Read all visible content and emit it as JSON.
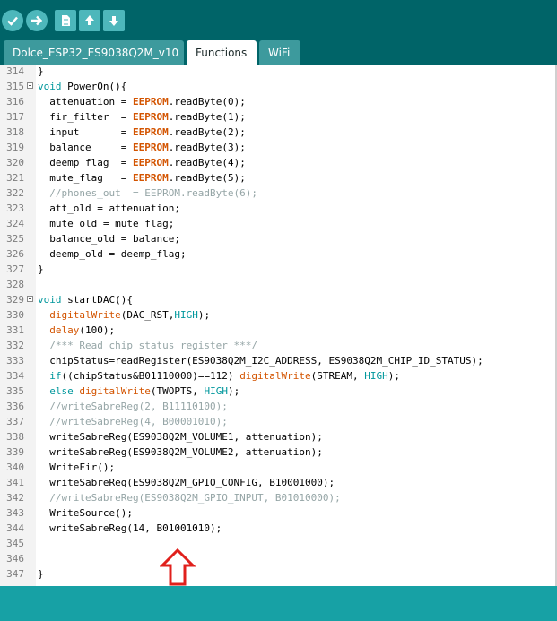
{
  "toolbar": {
    "buttons": [
      {
        "name": "verify-button",
        "icon": "checkmark-icon"
      },
      {
        "name": "upload-button",
        "icon": "arrow-right-icon"
      },
      {
        "name": "new-button",
        "icon": "new-file-icon"
      },
      {
        "name": "open-button",
        "icon": "arrow-up-icon"
      },
      {
        "name": "save-button",
        "icon": "arrow-down-icon"
      }
    ]
  },
  "tabs": [
    {
      "label": "Dolce_ESP32_ES9038Q2M_v10",
      "active": false
    },
    {
      "label": "Functions",
      "active": true
    },
    {
      "label": "WiFi",
      "active": false
    }
  ],
  "editor": {
    "lines": [
      {
        "num": "314",
        "fold": false,
        "tokens": [
          {
            "t": "}",
            "c": "p"
          }
        ]
      },
      {
        "num": "315",
        "fold": true,
        "tokens": [
          {
            "t": "void",
            "c": "kw"
          },
          {
            "t": " PowerOn(){",
            "c": "p"
          }
        ]
      },
      {
        "num": "316",
        "fold": false,
        "tokens": [
          {
            "t": "  attenuation = ",
            "c": "p"
          },
          {
            "t": "EEPROM",
            "c": "obj"
          },
          {
            "t": ".readByte(0);",
            "c": "p"
          }
        ]
      },
      {
        "num": "317",
        "fold": false,
        "tokens": [
          {
            "t": "  fir_filter  = ",
            "c": "p"
          },
          {
            "t": "EEPROM",
            "c": "obj"
          },
          {
            "t": ".readByte(1);",
            "c": "p"
          }
        ]
      },
      {
        "num": "318",
        "fold": false,
        "tokens": [
          {
            "t": "  input       = ",
            "c": "p"
          },
          {
            "t": "EEPROM",
            "c": "obj"
          },
          {
            "t": ".readByte(2);",
            "c": "p"
          }
        ]
      },
      {
        "num": "319",
        "fold": false,
        "tokens": [
          {
            "t": "  balance     = ",
            "c": "p"
          },
          {
            "t": "EEPROM",
            "c": "obj"
          },
          {
            "t": ".readByte(3);",
            "c": "p"
          }
        ]
      },
      {
        "num": "320",
        "fold": false,
        "tokens": [
          {
            "t": "  deemp_flag  = ",
            "c": "p"
          },
          {
            "t": "EEPROM",
            "c": "obj"
          },
          {
            "t": ".readByte(4);",
            "c": "p"
          }
        ]
      },
      {
        "num": "321",
        "fold": false,
        "tokens": [
          {
            "t": "  mute_flag   = ",
            "c": "p"
          },
          {
            "t": "EEPROM",
            "c": "obj"
          },
          {
            "t": ".readByte(5);",
            "c": "p"
          }
        ]
      },
      {
        "num": "322",
        "fold": false,
        "tokens": [
          {
            "t": "  //phones_out  = EEPROM.readByte(6);",
            "c": "cm"
          }
        ]
      },
      {
        "num": "323",
        "fold": false,
        "tokens": [
          {
            "t": "  att_old = attenuation;",
            "c": "p"
          }
        ]
      },
      {
        "num": "324",
        "fold": false,
        "tokens": [
          {
            "t": "  mute_old = mute_flag;",
            "c": "p"
          }
        ]
      },
      {
        "num": "325",
        "fold": false,
        "tokens": [
          {
            "t": "  balance_old = balance;",
            "c": "p"
          }
        ]
      },
      {
        "num": "326",
        "fold": false,
        "tokens": [
          {
            "t": "  deemp_old = deemp_flag;",
            "c": "p"
          }
        ]
      },
      {
        "num": "327",
        "fold": false,
        "tokens": [
          {
            "t": "}",
            "c": "p"
          }
        ]
      },
      {
        "num": "328",
        "fold": false,
        "tokens": []
      },
      {
        "num": "329",
        "fold": true,
        "tokens": [
          {
            "t": "void",
            "c": "kw"
          },
          {
            "t": " startDAC(){",
            "c": "p"
          }
        ]
      },
      {
        "num": "330",
        "fold": false,
        "tokens": [
          {
            "t": "  ",
            "c": "p"
          },
          {
            "t": "digitalWrite",
            "c": "fn"
          },
          {
            "t": "(DAC_RST,",
            "c": "p"
          },
          {
            "t": "HIGH",
            "c": "kw"
          },
          {
            "t": ");",
            "c": "p"
          }
        ]
      },
      {
        "num": "331",
        "fold": false,
        "tokens": [
          {
            "t": "  ",
            "c": "p"
          },
          {
            "t": "delay",
            "c": "fn"
          },
          {
            "t": "(100);",
            "c": "p"
          }
        ]
      },
      {
        "num": "332",
        "fold": false,
        "tokens": [
          {
            "t": "  /*** Read chip status register ***/",
            "c": "cm"
          }
        ]
      },
      {
        "num": "333",
        "fold": false,
        "tokens": [
          {
            "t": "  chipStatus=readRegister(ES9038Q2M_I2C_ADDRESS, ES9038Q2M_CHIP_ID_STATUS);",
            "c": "p"
          }
        ]
      },
      {
        "num": "334",
        "fold": false,
        "tokens": [
          {
            "t": "  ",
            "c": "p"
          },
          {
            "t": "if",
            "c": "kw"
          },
          {
            "t": "((chipStatus&B01110000)==112) ",
            "c": "p"
          },
          {
            "t": "digitalWrite",
            "c": "fn"
          },
          {
            "t": "(STREAM, ",
            "c": "p"
          },
          {
            "t": "HIGH",
            "c": "kw"
          },
          {
            "t": ");",
            "c": "p"
          }
        ]
      },
      {
        "num": "335",
        "fold": false,
        "tokens": [
          {
            "t": "  ",
            "c": "p"
          },
          {
            "t": "else",
            "c": "kw"
          },
          {
            "t": " ",
            "c": "p"
          },
          {
            "t": "digitalWrite",
            "c": "fn"
          },
          {
            "t": "(TWOPTS, ",
            "c": "p"
          },
          {
            "t": "HIGH",
            "c": "kw"
          },
          {
            "t": ");",
            "c": "p"
          }
        ]
      },
      {
        "num": "336",
        "fold": false,
        "tokens": [
          {
            "t": "  //writeSabreReg(2, B11110100);",
            "c": "cm"
          }
        ]
      },
      {
        "num": "337",
        "fold": false,
        "tokens": [
          {
            "t": "  //writeSabreReg(4, B00001010);",
            "c": "cm"
          }
        ]
      },
      {
        "num": "338",
        "fold": false,
        "tokens": [
          {
            "t": "  writeSabreReg(ES9038Q2M_VOLUME1, attenuation);",
            "c": "p"
          }
        ]
      },
      {
        "num": "339",
        "fold": false,
        "tokens": [
          {
            "t": "  writeSabreReg(ES9038Q2M_VOLUME2, attenuation);",
            "c": "p"
          }
        ]
      },
      {
        "num": "340",
        "fold": false,
        "tokens": [
          {
            "t": "  WriteFir();",
            "c": "p"
          }
        ]
      },
      {
        "num": "341",
        "fold": false,
        "tokens": [
          {
            "t": "  writeSabreReg(ES9038Q2M_GPIO_CONFIG, B10001000);",
            "c": "p"
          }
        ]
      },
      {
        "num": "342",
        "fold": false,
        "tokens": [
          {
            "t": "  //writeSabreReg(ES9038Q2M_GPIO_INPUT, B01010000);",
            "c": "cm"
          }
        ]
      },
      {
        "num": "343",
        "fold": false,
        "tokens": [
          {
            "t": "  WriteSource();",
            "c": "p"
          }
        ]
      },
      {
        "num": "344",
        "fold": false,
        "tokens": [
          {
            "t": "  writeSabreReg(14, B01001010);",
            "c": "p"
          }
        ]
      },
      {
        "num": "345",
        "fold": false,
        "tokens": []
      },
      {
        "num": "346",
        "fold": false,
        "tokens": []
      },
      {
        "num": "347",
        "fold": false,
        "tokens": [
          {
            "t": "}",
            "c": "p"
          }
        ]
      }
    ]
  },
  "annotation": {
    "icon": "red-up-arrow-icon",
    "color": "#e0201c"
  },
  "colors": {
    "toolbar": "#006468",
    "status": "#17a1a5",
    "keyword": "#00979c",
    "function": "#d35400",
    "comment": "#95a5a6"
  }
}
